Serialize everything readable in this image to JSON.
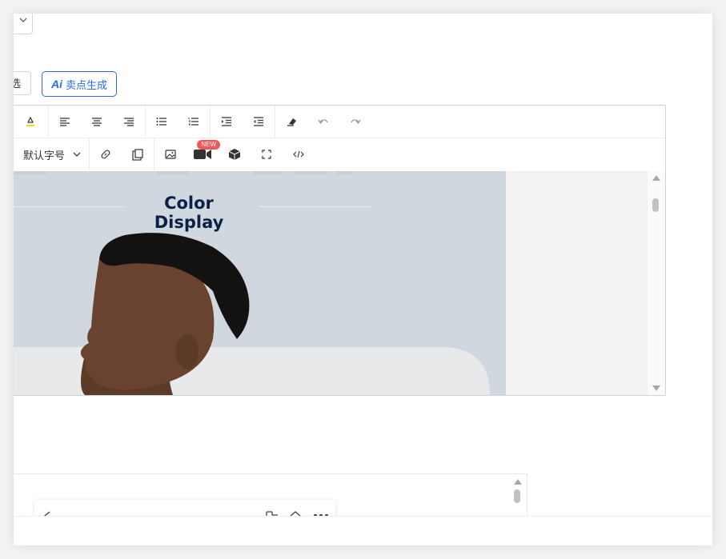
{
  "top_control": {
    "partial_button_label": "选"
  },
  "ai_button": {
    "mark": "Ai",
    "label": "卖点生成"
  },
  "toolbar": {
    "row1_icons": [
      "text-highlight-icon",
      "align-left-icon",
      "align-center-icon",
      "align-right-icon",
      "bullet-list-icon",
      "numbered-list-icon",
      "indent-increase-icon",
      "indent-decrease-icon",
      "clear-format-icon",
      "undo-icon",
      "redo-icon"
    ],
    "font_size_label": "默认字号",
    "row2_icons": [
      "link-icon",
      "paste-icon",
      "image-icon",
      "video-icon",
      "3d-model-icon",
      "fullscreen-icon",
      "code-view-icon"
    ],
    "new_badge": "NEW",
    "highlight_color": "#f5d90a"
  },
  "content": {
    "banner_title": "Color Display",
    "title_color": "#0b2044",
    "banner_bg": "#d1d7de"
  },
  "colors": {
    "accent": "#2b6de8",
    "badge": "#ef5a5a"
  }
}
